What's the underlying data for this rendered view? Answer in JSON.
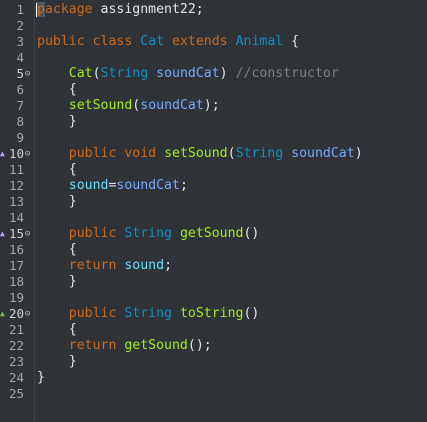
{
  "editor": {
    "lines": [
      {
        "num": "1",
        "tokens": [
          {
            "t": "package",
            "c": "kw"
          },
          {
            "t": " assignment22;",
            "c": "plain"
          }
        ]
      },
      {
        "num": "2",
        "tokens": []
      },
      {
        "num": "3",
        "tokens": [
          {
            "t": "public",
            "c": "kw"
          },
          {
            "t": " ",
            "c": "plain"
          },
          {
            "t": "class",
            "c": "kw"
          },
          {
            "t": " ",
            "c": "plain"
          },
          {
            "t": "Cat",
            "c": "type"
          },
          {
            "t": " ",
            "c": "plain"
          },
          {
            "t": "extends",
            "c": "kw"
          },
          {
            "t": " ",
            "c": "plain"
          },
          {
            "t": "Animal",
            "c": "type"
          },
          {
            "t": " {",
            "c": "plain"
          }
        ]
      },
      {
        "num": "4",
        "tokens": []
      },
      {
        "num": "5",
        "fold": true,
        "tokens": [
          {
            "t": "    ",
            "c": "plain"
          },
          {
            "t": "Cat",
            "c": "method"
          },
          {
            "t": "(",
            "c": "plain"
          },
          {
            "t": "String",
            "c": "type"
          },
          {
            "t": " ",
            "c": "plain"
          },
          {
            "t": "soundCat",
            "c": "param"
          },
          {
            "t": ") ",
            "c": "plain"
          },
          {
            "t": "//constructor",
            "c": "comment"
          }
        ]
      },
      {
        "num": "6",
        "tokens": [
          {
            "t": "    {",
            "c": "plain"
          }
        ]
      },
      {
        "num": "7",
        "tokens": [
          {
            "t": "    ",
            "c": "plain"
          },
          {
            "t": "setSound",
            "c": "method"
          },
          {
            "t": "(",
            "c": "plain"
          },
          {
            "t": "soundCat",
            "c": "param"
          },
          {
            "t": ");",
            "c": "plain"
          }
        ]
      },
      {
        "num": "8",
        "tokens": [
          {
            "t": "    }",
            "c": "plain"
          }
        ]
      },
      {
        "num": "9",
        "tokens": []
      },
      {
        "num": "10",
        "fold": true,
        "override": "purple",
        "tokens": [
          {
            "t": "    ",
            "c": "plain"
          },
          {
            "t": "public",
            "c": "kw"
          },
          {
            "t": " ",
            "c": "plain"
          },
          {
            "t": "void",
            "c": "kw"
          },
          {
            "t": " ",
            "c": "plain"
          },
          {
            "t": "setSound",
            "c": "method"
          },
          {
            "t": "(",
            "c": "plain"
          },
          {
            "t": "String",
            "c": "type"
          },
          {
            "t": " ",
            "c": "plain"
          },
          {
            "t": "soundCat",
            "c": "param"
          },
          {
            "t": ")",
            "c": "plain"
          }
        ]
      },
      {
        "num": "11",
        "tokens": [
          {
            "t": "    {",
            "c": "plain"
          }
        ]
      },
      {
        "num": "12",
        "tokens": [
          {
            "t": "    ",
            "c": "plain"
          },
          {
            "t": "sound",
            "c": "field"
          },
          {
            "t": "=",
            "c": "plain"
          },
          {
            "t": "soundCat",
            "c": "param"
          },
          {
            "t": ";",
            "c": "plain"
          }
        ]
      },
      {
        "num": "13",
        "tokens": [
          {
            "t": "    }",
            "c": "plain"
          }
        ]
      },
      {
        "num": "14",
        "tokens": []
      },
      {
        "num": "15",
        "fold": true,
        "override": "purple",
        "tokens": [
          {
            "t": "    ",
            "c": "plain"
          },
          {
            "t": "public",
            "c": "kw"
          },
          {
            "t": " ",
            "c": "plain"
          },
          {
            "t": "String",
            "c": "type"
          },
          {
            "t": " ",
            "c": "plain"
          },
          {
            "t": "getSound",
            "c": "method"
          },
          {
            "t": "()",
            "c": "plain"
          }
        ]
      },
      {
        "num": "16",
        "tokens": [
          {
            "t": "    {",
            "c": "plain"
          }
        ]
      },
      {
        "num": "17",
        "tokens": [
          {
            "t": "    ",
            "c": "plain"
          },
          {
            "t": "return",
            "c": "kw"
          },
          {
            "t": " ",
            "c": "plain"
          },
          {
            "t": "sound",
            "c": "field"
          },
          {
            "t": ";",
            "c": "plain"
          }
        ]
      },
      {
        "num": "18",
        "tokens": [
          {
            "t": "    }",
            "c": "plain"
          }
        ]
      },
      {
        "num": "19",
        "tokens": []
      },
      {
        "num": "20",
        "fold": true,
        "override": "green",
        "tokens": [
          {
            "t": "    ",
            "c": "plain"
          },
          {
            "t": "public",
            "c": "kw"
          },
          {
            "t": " ",
            "c": "plain"
          },
          {
            "t": "String",
            "c": "type"
          },
          {
            "t": " ",
            "c": "plain"
          },
          {
            "t": "toString",
            "c": "method"
          },
          {
            "t": "()",
            "c": "plain"
          }
        ]
      },
      {
        "num": "21",
        "tokens": [
          {
            "t": "    {",
            "c": "plain"
          }
        ]
      },
      {
        "num": "22",
        "tokens": [
          {
            "t": "    ",
            "c": "plain"
          },
          {
            "t": "return",
            "c": "kw"
          },
          {
            "t": " ",
            "c": "plain"
          },
          {
            "t": "getSound",
            "c": "method"
          },
          {
            "t": "();",
            "c": "plain"
          }
        ]
      },
      {
        "num": "23",
        "tokens": [
          {
            "t": "    }",
            "c": "plain"
          }
        ]
      },
      {
        "num": "24",
        "tokens": [
          {
            "t": "}",
            "c": "plain"
          }
        ]
      },
      {
        "num": "25",
        "tokens": []
      }
    ],
    "colors": {
      "background": "#2f3337",
      "keyword": "#cc6c1d",
      "type": "#1290c3",
      "method": "#a7ec21",
      "field": "#66e1f8",
      "param": "#79abff",
      "comment": "#808080",
      "text": "#e6e6e6"
    }
  }
}
